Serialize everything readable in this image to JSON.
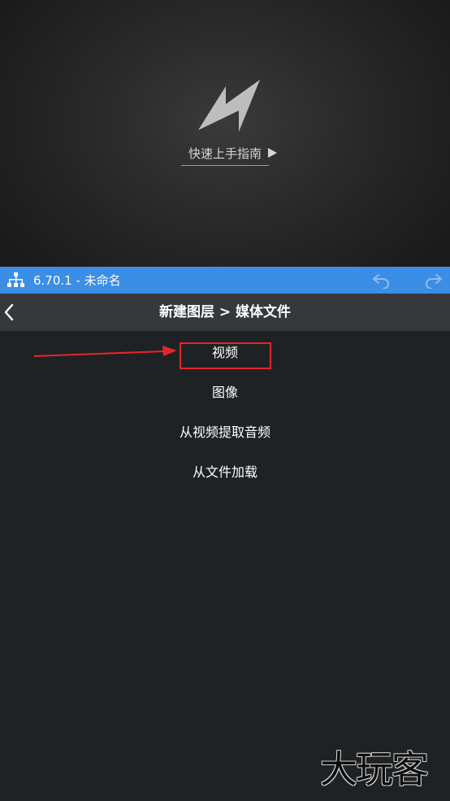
{
  "preview": {
    "logo_icon": "app-logo-icon",
    "guide_label": "快速上手指南",
    "guide_arrow_icon": "play-triangle-icon"
  },
  "title_bar": {
    "color": "#3a8ee6",
    "tree_icon": "node-tree-icon",
    "title": "6.70.1 - 未命名",
    "undo_icon": "undo-icon",
    "redo_icon": "redo-icon"
  },
  "nav": {
    "back_icon": "chevron-left-icon",
    "breadcrumb": "新建图层 > 媒体文件"
  },
  "menu": {
    "items": [
      {
        "label": "视频"
      },
      {
        "label": "图像"
      },
      {
        "label": "从视频提取音频"
      },
      {
        "label": "从文件加载"
      }
    ],
    "highlight_color": "#e4262b"
  },
  "watermark": {
    "text": "大玩客"
  }
}
